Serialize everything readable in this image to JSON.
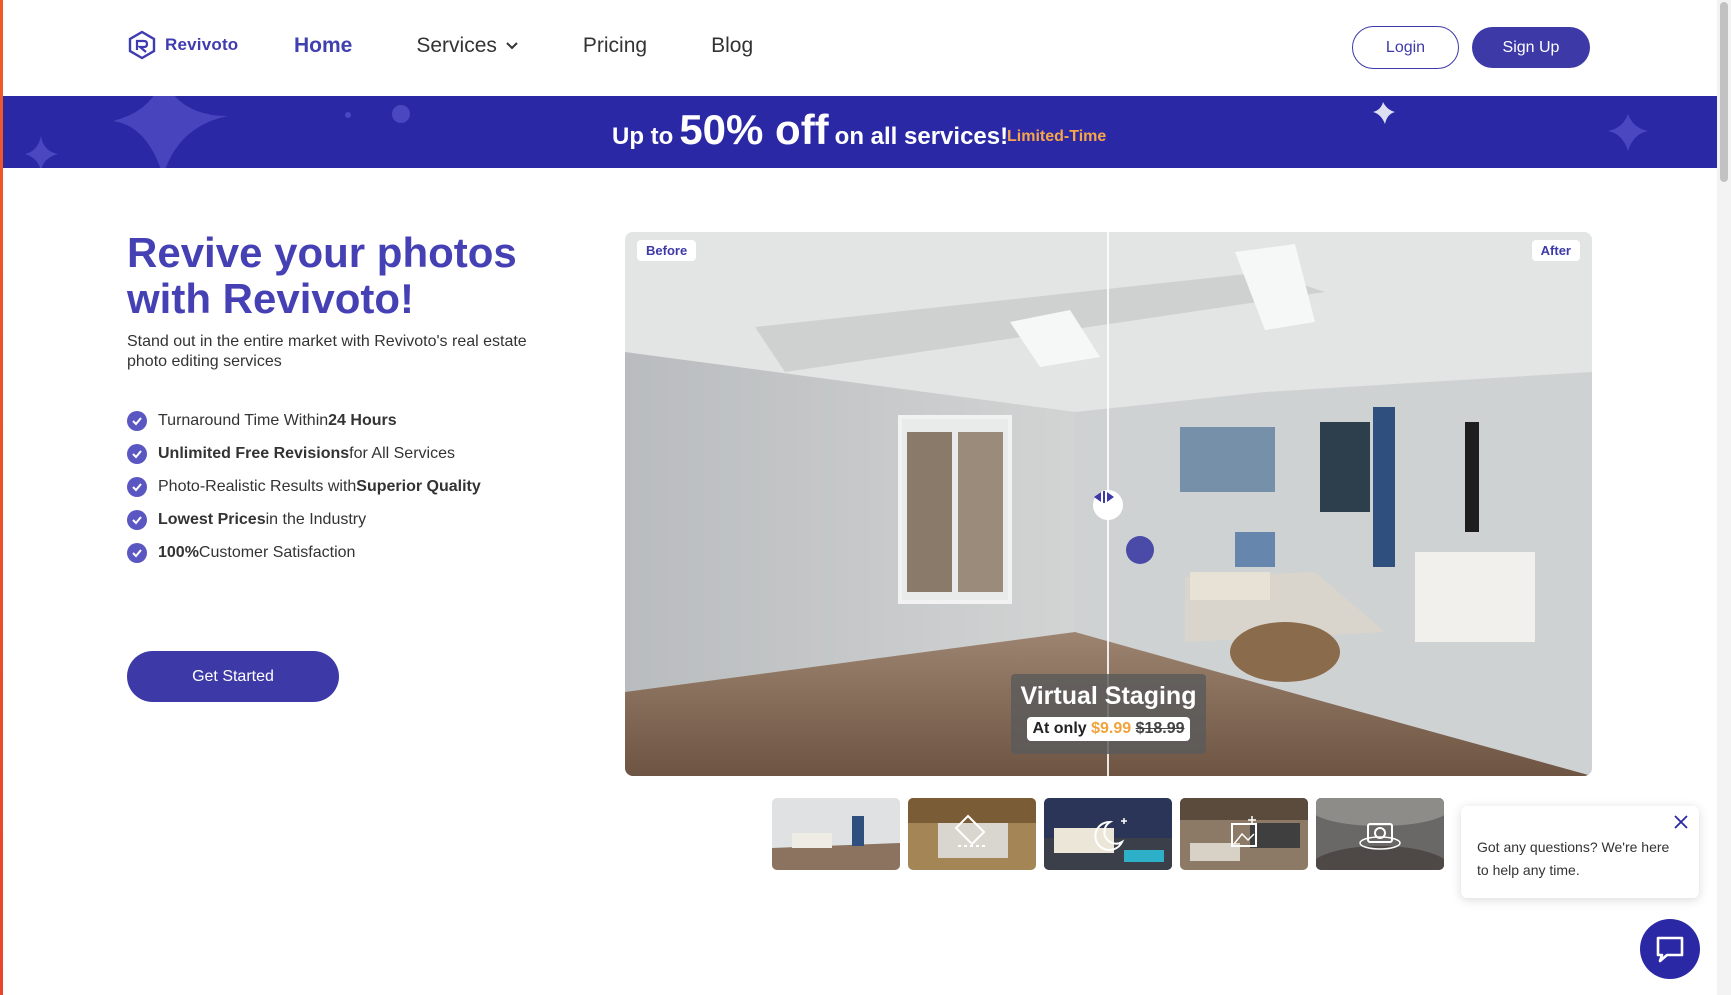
{
  "header": {
    "logo_text": "Revivoto",
    "nav": [
      "Home",
      "Services",
      "Pricing",
      "Blog"
    ],
    "login_label": "Login",
    "signup_label": "Sign Up"
  },
  "banner": {
    "prefix": "Up to",
    "percent": "50% off",
    "suffix": "on all services!",
    "tag": "Limited-Time"
  },
  "hero": {
    "title": "Revive your photos with Revivoto!",
    "subtitle": "Stand out in the entire market with Revivoto's real estate photo editing services",
    "features": [
      {
        "pre": "Turnaround Time Within ",
        "bold": "24 Hours",
        "post": ""
      },
      {
        "pre": "",
        "bold": "Unlimited Free Revisions",
        "post": " for All Services"
      },
      {
        "pre": "Photo-Realistic Results with ",
        "bold": "Superior Quality",
        "post": ""
      },
      {
        "pre": "",
        "bold": "Lowest Prices",
        "post": " in the Industry"
      },
      {
        "pre": "",
        "bold": "100%",
        "post": " Customer Satisfaction"
      }
    ],
    "cta_label": "Get Started"
  },
  "compare": {
    "before_label": "Before",
    "after_label": "After",
    "service_title": "Virtual Staging",
    "price_prefix": "At only",
    "price_new": "$9.99",
    "price_old": "$18.99"
  },
  "thumbnails": [
    "virtual-staging-thumb",
    "item-removal-thumb",
    "day-to-dusk-thumb",
    "image-enhancement-thumb",
    "virtual-tour-thumb"
  ],
  "chat": {
    "message": "Got any questions? We're here to help any time."
  },
  "colors": {
    "brand": "#3d3aa8",
    "banner": "#2b28a6",
    "accent_orange": "#f2a23a"
  }
}
